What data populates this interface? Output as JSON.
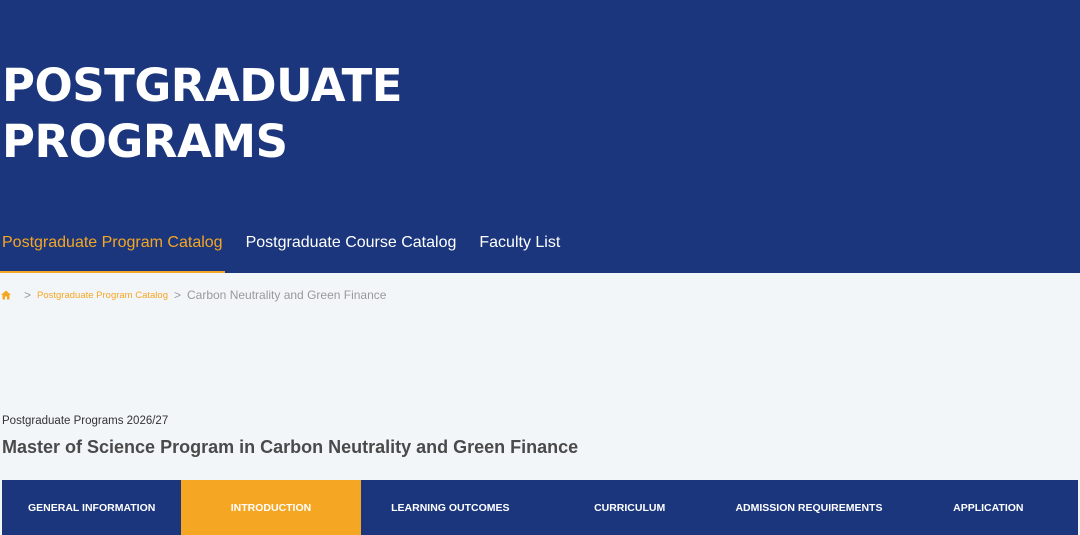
{
  "header": {
    "title_line1": "POSTGRADUATE",
    "title_line2": "PROGRAMS",
    "nav": [
      {
        "label": "Postgraduate Program Catalog",
        "active": true
      },
      {
        "label": "Postgraduate Course Catalog",
        "active": false
      },
      {
        "label": "Faculty List",
        "active": false
      }
    ]
  },
  "breadcrumb": {
    "home_icon": "home-icon",
    "separator": ">",
    "link": "Postgraduate Program Catalog",
    "current": "Carbon Neutrality and Green Finance"
  },
  "main": {
    "subtitle": "Postgraduate Programs 2026/27",
    "title": "Master of Science Program in Carbon Neutrality and Green Finance"
  },
  "tabs": [
    {
      "label": "GENERAL INFORMATION",
      "active": false
    },
    {
      "label": "INTRODUCTION",
      "active": true
    },
    {
      "label": "LEARNING OUTCOMES",
      "active": false
    },
    {
      "label": "CURRICULUM",
      "active": false
    },
    {
      "label": "ADMISSION REQUIREMENTS",
      "active": false
    },
    {
      "label": "APPLICATION",
      "active": false
    }
  ],
  "colors": {
    "brand_navy": "#1b367c",
    "accent_orange": "#f5a623",
    "page_background": "#f3f6f9"
  }
}
